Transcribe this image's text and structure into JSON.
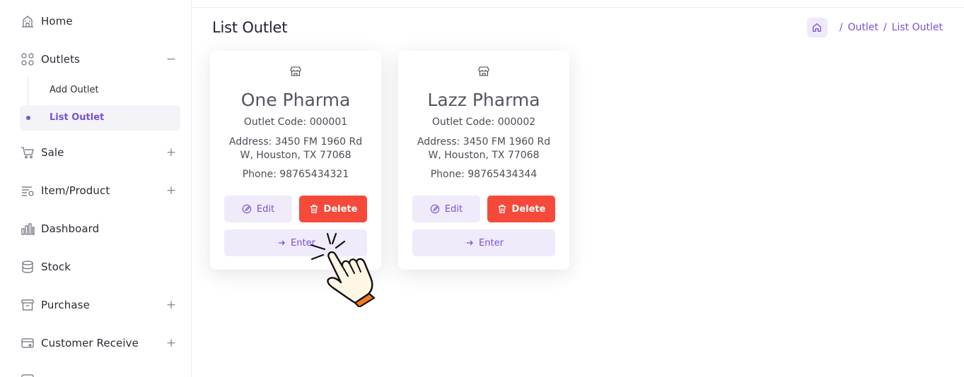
{
  "sidebar": {
    "items": [
      {
        "label": "Home",
        "icon": "home-icon",
        "toggle": ""
      },
      {
        "label": "Outlets",
        "icon": "grid-icon",
        "toggle": "−"
      },
      {
        "label": "Sale",
        "icon": "cart-icon",
        "toggle": "+"
      },
      {
        "label": "Item/Product",
        "icon": "list-icon",
        "toggle": "+"
      },
      {
        "label": "Dashboard",
        "icon": "bar-chart-icon",
        "toggle": ""
      },
      {
        "label": "Stock",
        "icon": "database-icon",
        "toggle": ""
      },
      {
        "label": "Purchase",
        "icon": "archive-icon",
        "toggle": "+"
      },
      {
        "label": "Customer Receive",
        "icon": "receive-icon",
        "toggle": "+"
      }
    ],
    "outlet_sub": [
      {
        "label": "Add Outlet"
      },
      {
        "label": "List Outlet"
      }
    ]
  },
  "page": {
    "title": "List Outlet"
  },
  "breadcrumb": {
    "items": [
      "Outlet",
      "List Outlet"
    ],
    "separator": "/"
  },
  "cards": [
    {
      "name": "One Pharma",
      "code": "Outlet Code: 000001",
      "address": "Address: 3450 FM 1960 Rd W, Houston, TX 77068",
      "phone": "Phone: 98765434321",
      "edit": "Edit",
      "delete": "Delete",
      "enter": "Enter"
    },
    {
      "name": "Lazz Pharma",
      "code": "Outlet Code: 000002",
      "address": "Address: 3450 FM 1960 Rd W, Houston, TX 77068",
      "phone": "Phone: 98765434344",
      "edit": "Edit",
      "delete": "Delete",
      "enter": "Enter"
    }
  ],
  "colors": {
    "accent": "#7b4fd6",
    "danger": "#f5493a",
    "accent_soft": "#f0ebfb"
  }
}
